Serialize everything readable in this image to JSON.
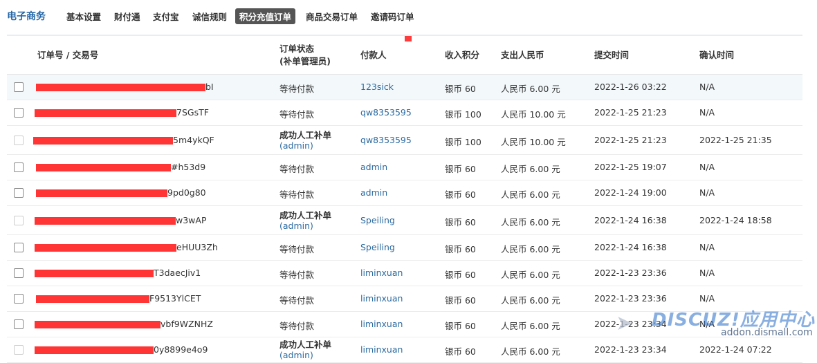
{
  "nav": {
    "brand": "电子商务",
    "items": [
      "基本设置",
      "财付通",
      "支付宝",
      "诚信规则",
      "积分充值订单",
      "商品交易订单",
      "邀请码订单"
    ],
    "active_index": 4
  },
  "table": {
    "headers": {
      "order_no": "订单号 / 交易号",
      "status_line1": "订单状态",
      "status_line2": "(补单管理员)",
      "payer": "付款人",
      "credit_in": "收入积分",
      "rmb_out": "支出人民币",
      "submit_time": "提交时间",
      "confirm_time": "确认时间"
    },
    "rows": [
      {
        "order_tail": "bI",
        "status": "等待付款",
        "manual": false,
        "admin": "",
        "payer": "123sick",
        "credit": "银币 60",
        "rmb": "人民币 6.00 元",
        "submit": "2022-1-26 03:22",
        "confirm": "N/A",
        "checkbox_enabled": true
      },
      {
        "order_tail": "7SGsTF",
        "status": "等待付款",
        "manual": false,
        "admin": "",
        "payer": "qw8353595",
        "credit": "银币 100",
        "rmb": "人民币 10.00 元",
        "submit": "2022-1-25 21:23",
        "confirm": "N/A",
        "checkbox_enabled": true
      },
      {
        "order_tail": "5m4ykQF",
        "status": "成功人工补单",
        "manual": true,
        "admin": "(admin)",
        "payer": "qw8353595",
        "credit": "银币 100",
        "rmb": "人民币 10.00 元",
        "submit": "2022-1-25 21:23",
        "confirm": "2022-1-25 21:35",
        "checkbox_enabled": false
      },
      {
        "order_tail": "#h53d9",
        "status": "等待付款",
        "manual": false,
        "admin": "",
        "payer": "admin",
        "credit": "银币 60",
        "rmb": "人民币 6.00 元",
        "submit": "2022-1-25 19:07",
        "confirm": "N/A",
        "checkbox_enabled": true
      },
      {
        "order_tail": "9pd0g80",
        "status": "等待付款",
        "manual": false,
        "admin": "",
        "payer": "admin",
        "credit": "银币 60",
        "rmb": "人民币 6.00 元",
        "submit": "2022-1-24 19:00",
        "confirm": "N/A",
        "checkbox_enabled": true
      },
      {
        "order_tail": "w3wAP",
        "status": "成功人工补单",
        "manual": true,
        "admin": "(admin)",
        "payer": "Speiling",
        "credit": "银币 60",
        "rmb": "人民币 6.00 元",
        "submit": "2022-1-24 16:38",
        "confirm": "2022-1-24 18:58",
        "checkbox_enabled": false
      },
      {
        "order_tail": "eHUU3Zh",
        "status": "等待付款",
        "manual": false,
        "admin": "",
        "payer": "Speiling",
        "credit": "银币 60",
        "rmb": "人民币 6.00 元",
        "submit": "2022-1-24 16:38",
        "confirm": "N/A",
        "checkbox_enabled": true
      },
      {
        "order_tail": "T3daecJiv1",
        "status": "等待付款",
        "manual": false,
        "admin": "",
        "payer": "liminxuan",
        "credit": "银币 60",
        "rmb": "人民币 6.00 元",
        "submit": "2022-1-23 23:36",
        "confirm": "N/A",
        "checkbox_enabled": true
      },
      {
        "order_tail": "F9513YlCET",
        "status": "等待付款",
        "manual": false,
        "admin": "",
        "payer": "liminxuan",
        "credit": "银币 60",
        "rmb": "人民币 6.00 元",
        "submit": "2022-1-23 23:36",
        "confirm": "N/A",
        "checkbox_enabled": true
      },
      {
        "order_tail": "vbf9WZNHZ",
        "status": "等待付款",
        "manual": false,
        "admin": "",
        "payer": "liminxuan",
        "credit": "银币 60",
        "rmb": "人民币 6.00 元",
        "submit": "2022-1-23 23:34",
        "confirm": "N/A",
        "checkbox_enabled": true
      },
      {
        "order_tail": "0y8899e4o9",
        "status": "成功人工补单",
        "manual": true,
        "admin": "(admin)",
        "payer": "liminxuan",
        "credit": "银币 60",
        "rmb": "人民币 6.00 元",
        "submit": "2022-1-23 23:34",
        "confirm": "2022-1-24 07:22",
        "checkbox_enabled": false
      }
    ]
  },
  "watermark": {
    "main": "DISCUZ!应用中心",
    "sub": "addon.dismall.com"
  },
  "colors": {
    "brand": "#2366a8",
    "link": "#2c6aa0",
    "redaction": "#ff3535",
    "active_tab_bg": "#555555"
  }
}
